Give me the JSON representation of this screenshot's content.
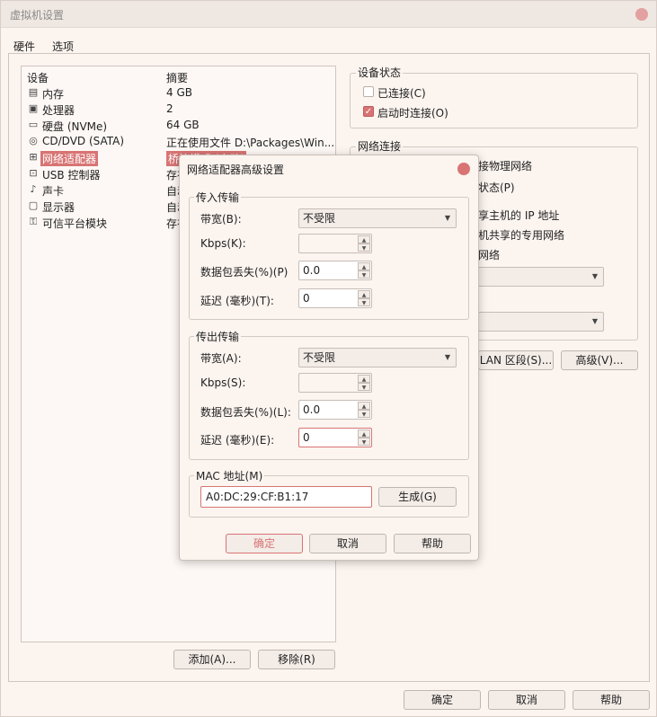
{
  "window": {
    "title": "虚拟机设置"
  },
  "tabs": [
    "硬件",
    "选项"
  ],
  "devices": {
    "header_device": "设备",
    "header_summary": "摘要",
    "items": [
      {
        "icon": "memory-icon",
        "name": "内存",
        "summary": "4 GB"
      },
      {
        "icon": "cpu-icon",
        "name": "处理器",
        "summary": "2"
      },
      {
        "icon": "disk-icon",
        "name": "硬盘 (NVMe)",
        "summary": "64 GB"
      },
      {
        "icon": "cd-icon",
        "name": "CD/DVD (SATA)",
        "summary": "正在使用文件 D:\\Packages\\Win..."
      },
      {
        "icon": "network-icon",
        "name": "网络适配器",
        "summary": "桥接模式 (自动)"
      },
      {
        "icon": "usb-icon",
        "name": "USB 控制器",
        "summary": "存在"
      },
      {
        "icon": "sound-icon",
        "name": "声卡",
        "summary": "自动检测"
      },
      {
        "icon": "display-icon",
        "name": "显示器",
        "summary": "自动检测"
      },
      {
        "icon": "tpm-icon",
        "name": "可信平台模块",
        "summary": "存在"
      }
    ],
    "add_button": "添加(A)...",
    "remove_button": "移除(R)"
  },
  "device_status": {
    "label": "设备状态",
    "connected": "已连接(C)",
    "connect_at_power_on": "启动时连接(O)"
  },
  "network_connection": {
    "label": "网络连接",
    "bridged_fragment": "接物理网络",
    "replicate_fragment": "状态(P)",
    "nat_fragment": "享主机的 IP 地址",
    "hostonly_fragment": "机共享的专用网络",
    "custom_fragment": "网络",
    "lan_segments_button": "LAN 区段(S)...",
    "advanced_button": "高级(V)..."
  },
  "footer": {
    "ok": "确定",
    "cancel": "取消",
    "help": "帮助"
  },
  "dialog": {
    "title": "网络适配器高级设置",
    "incoming": {
      "label": "传入传输",
      "bandwidth_label": "带宽(B):",
      "bandwidth_value": "不受限",
      "kbps_label": "Kbps(K):",
      "kbps_value": "",
      "loss_label": "数据包丢失(%)(P)",
      "loss_value": "0.0",
      "latency_label": "延迟 (毫秒)(T):",
      "latency_value": "0"
    },
    "outgoing": {
      "label": "传出传输",
      "bandwidth_label": "带宽(A):",
      "bandwidth_value": "不受限",
      "kbps_label": "Kbps(S):",
      "kbps_value": "",
      "loss_label": "数据包丢失(%)(L):",
      "loss_value": "0.0",
      "latency_label": "延迟 (毫秒)(E):",
      "latency_value": "0"
    },
    "mac": {
      "label": "MAC 地址(M)",
      "value": "A0:DC:29:CF:B1:17",
      "generate_button": "生成(G)"
    },
    "ok": "确定",
    "cancel": "取消",
    "help": "帮助"
  },
  "colors": {
    "accent": "#d87474",
    "background": "#fbf4ef"
  }
}
